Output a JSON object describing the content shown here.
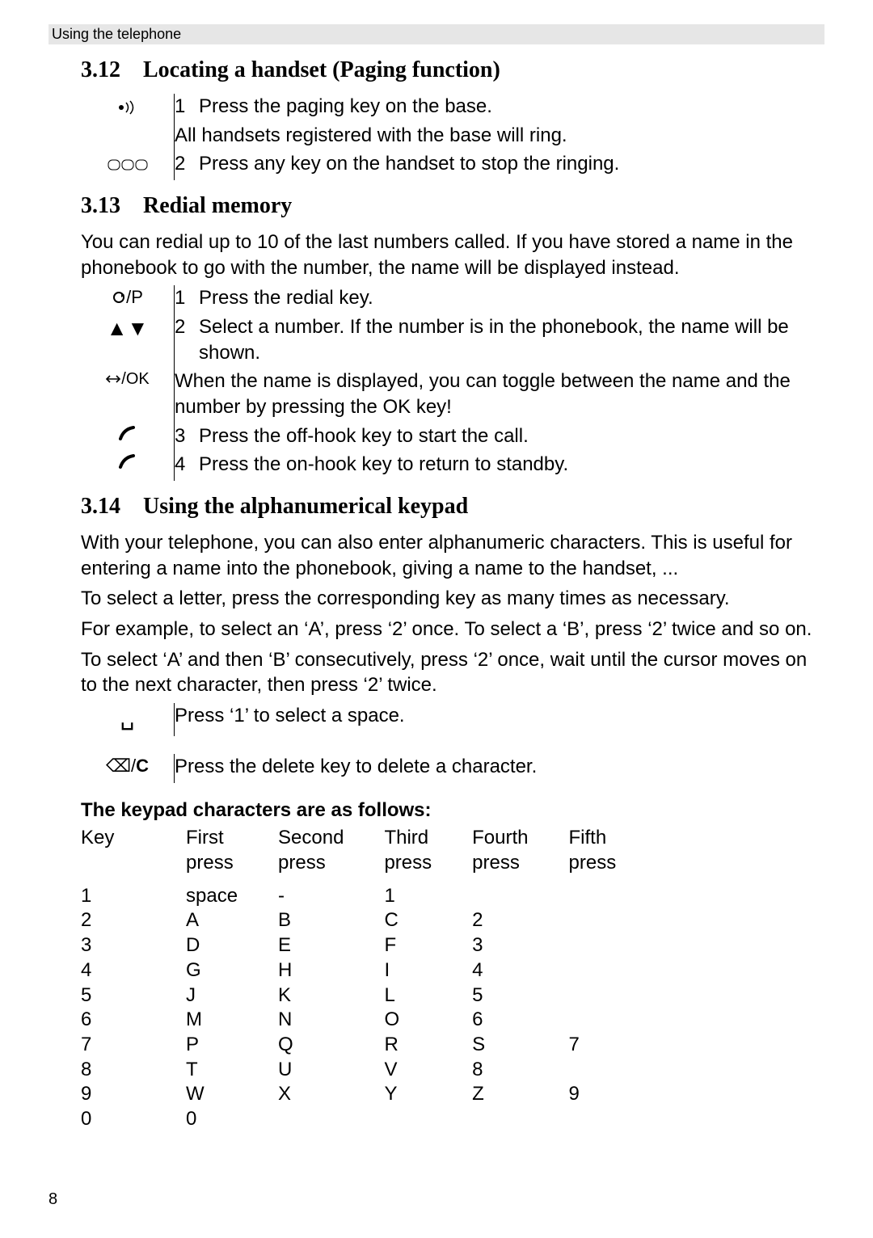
{
  "runningHead": "Using the telephone",
  "pageNumber": "8",
  "s312": {
    "num": "3.12",
    "title": "Locating a handset (Paging function)",
    "steps": [
      {
        "n": "1",
        "txt": "Press the paging key on the base."
      },
      {
        "txt": "All handsets registered with the base will ring."
      },
      {
        "n": "2",
        "txt": "Press any key on the handset to stop the ringing."
      }
    ]
  },
  "s313": {
    "num": "3.13",
    "title": "Redial memory",
    "intro": "You can redial up to 10 of the last numbers called. If you have stored a name in the phonebook to go with the number, the name will be displayed instead.",
    "steps": [
      {
        "n": "1",
        "txt": "Press the redial key."
      },
      {
        "n": "2",
        "txt": "Select a number. If the number is in the phonebook, the name will be shown."
      },
      {
        "txt": "When the name is displayed, you can toggle between the name and the number by pressing the OK key!"
      },
      {
        "n": "3",
        "txt": "Press the off-hook key to start the call."
      },
      {
        "n": "4",
        "txt": "Press the on-hook key to return to standby."
      }
    ],
    "icons": {
      "redial": "↻/P",
      "arrows": "▲▼",
      "ok": "↔/OK"
    }
  },
  "s314": {
    "num": "3.14",
    "title": "Using the alphanumerical keypad",
    "p1": "With your telephone, you can also enter alphanumeric characters. This is useful for entering a name into the phonebook, giving a name to the handset, ...",
    "p2": "To select a letter, press the corresponding key as many times as necessary.",
    "p3": "For example, to select an ‘A’, press ‘2’ once. To select a ‘B’, press ‘2’ twice and so on.",
    "p4": "To select ‘A’ and then ‘B’ consecutively, press ‘2’ once, wait until the cursor moves on to the next character, then press ‘2’ twice.",
    "spaceTip": "Press ‘1’ to select a space.",
    "deleteTip": "Press the delete key to delete a character.",
    "deleteIcon": "⌫/C",
    "spaceIcon": "␣"
  },
  "keypad": {
    "heading": "The keypad characters are as follows:",
    "cols": [
      "Key",
      "First press",
      "Second press",
      "Third press",
      "Fourth press",
      "Fifth press"
    ],
    "rows": [
      [
        "1",
        "space",
        "-",
        "1",
        "",
        ""
      ],
      [
        "2",
        "A",
        "B",
        "C",
        "2",
        ""
      ],
      [
        "3",
        "D",
        "E",
        "F",
        "3",
        ""
      ],
      [
        "4",
        "G",
        "H",
        "I",
        "4",
        ""
      ],
      [
        "5",
        "J",
        "K",
        "L",
        "5",
        ""
      ],
      [
        "6",
        "M",
        "N",
        "O",
        "6",
        ""
      ],
      [
        "7",
        "P",
        "Q",
        "R",
        "S",
        "7"
      ],
      [
        "8",
        "T",
        "U",
        "V",
        "8",
        ""
      ],
      [
        "9",
        "W",
        "X",
        "Y",
        "Z",
        "9"
      ],
      [
        "0",
        "0",
        "",
        "",
        "",
        ""
      ]
    ]
  }
}
